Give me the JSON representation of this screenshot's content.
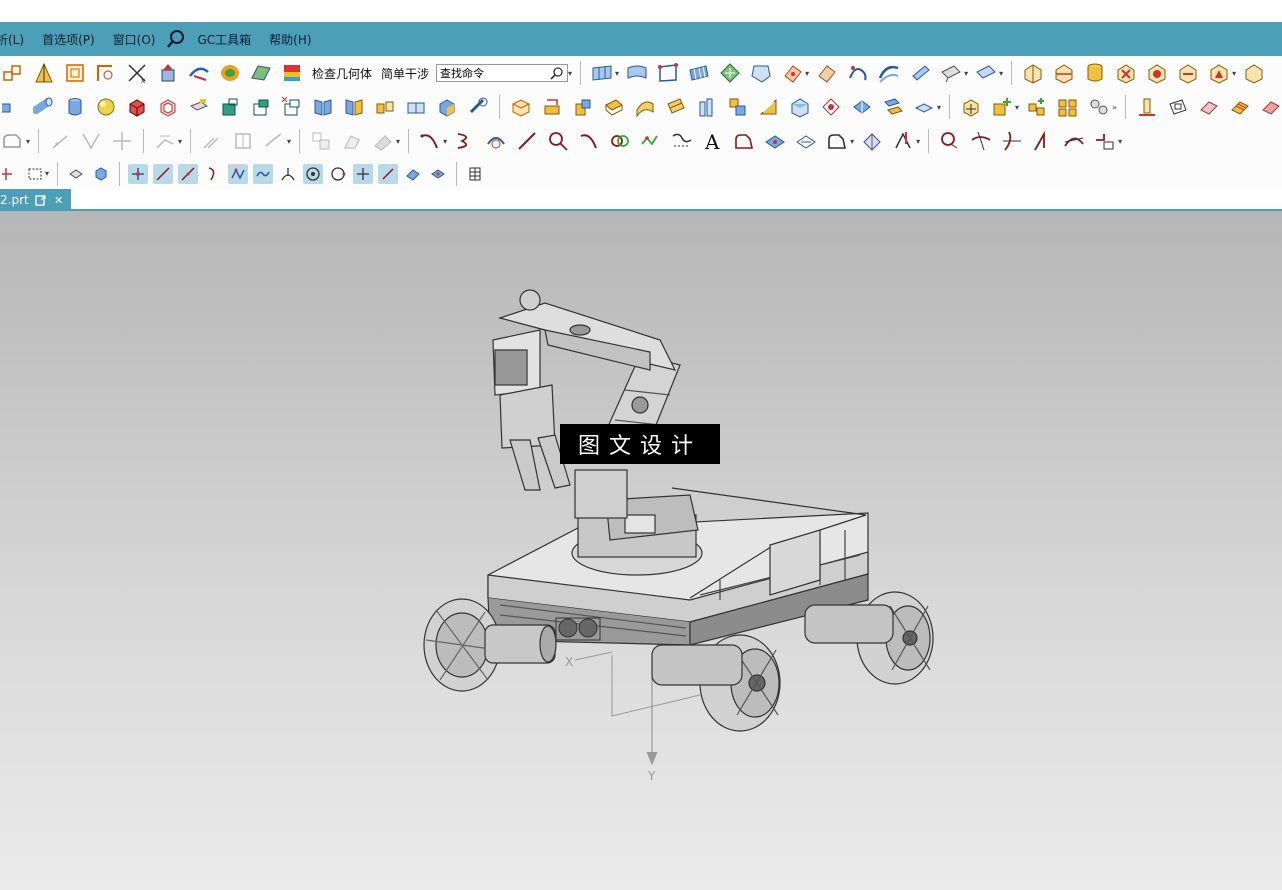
{
  "menubar": {
    "items": [
      "分析(L)",
      "首选项(P)",
      "窗口(O)",
      "GC工具箱",
      "帮助(H)"
    ],
    "first_item_visible": "析(L)"
  },
  "toolbar": {
    "check_geometry_label": "检查几何体",
    "simple_interference_label": "简单干涉",
    "command_search_value": "查找命令"
  },
  "tab": {
    "filename": "2.prt"
  },
  "viewport": {
    "watermark": "图文设计",
    "axis_x_label": "X",
    "axis_y_label": "Y"
  },
  "colors": {
    "accent": "#4d9fb8",
    "viewport_top": "#b6b6b6",
    "viewport_bottom": "#ebebeb"
  }
}
